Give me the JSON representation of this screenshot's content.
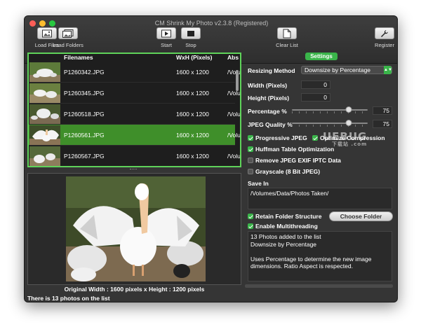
{
  "window": {
    "title": "CM Shrink My Photo v2.3.8 (Registered)"
  },
  "toolbar": {
    "load_files": "Load Files",
    "load_folders": "Load Folders",
    "start": "Start",
    "stop": "Stop",
    "clear_list": "Clear List",
    "register": "Register"
  },
  "filelist": {
    "columns": [
      "Filenames",
      "WxH (Pixels)",
      "Abs"
    ],
    "rows": [
      {
        "name": "P1260342.JPG",
        "dims": "1600 x 1200",
        "abs": "/Volu",
        "selected": false
      },
      {
        "name": "P1260345.JPG",
        "dims": "1600 x 1200",
        "abs": "/Volu",
        "selected": false
      },
      {
        "name": "P1260518.JPG",
        "dims": "1600 x 1200",
        "abs": "/Volu",
        "selected": false
      },
      {
        "name": "P1260561.JPG",
        "dims": "1600 x 1200",
        "abs": "/Volu",
        "selected": true
      },
      {
        "name": "P1260567.JPG",
        "dims": "1600 x 1200",
        "abs": "/Volu",
        "selected": false
      }
    ]
  },
  "preview": {
    "caption": "Original Width : 1600 pixels x Height : 1200 pixels",
    "status": "There is 13 photos on the list"
  },
  "settings": {
    "tab": "Settings",
    "resizing_method_label": "Resizing Method",
    "resizing_method_value": "Downsize by Percentage",
    "width_label": "Width (Pixels)",
    "width_value": "0",
    "height_label": "Height (Pixels)",
    "height_value": "0",
    "percentage_label": "Percentage %",
    "percentage_value": "75",
    "percentage_level": 0.75,
    "jpeg_quality_label": "JPEG Quality %",
    "jpeg_quality_value": "75",
    "jpeg_quality_level": 0.75,
    "progressive_jpeg": "Progressive JPEG",
    "optimize_compression": "Optimize Compression",
    "huffman": "Huffman Table Optimization",
    "remove_exif": "Remove JPEG EXIF  IPTC Data",
    "grayscale": "Grayscale (8 Bit JPEG)",
    "save_in_label": "Save In",
    "save_in_path": "/Volumes/Data/Photos Taken/",
    "retain_folder": "Retain Folder Structure",
    "enable_multithreading": "Enable Multithreading",
    "choose_folder": "Choose Folder",
    "log": "13 Photos added to the list\nDownsize by Percentage\n\nUses Percentage to determine the new image dimensions. Ratio Aspect is respected."
  },
  "watermark": {
    "text": "UEBUG",
    "sub": "下载站 .com"
  },
  "colors": {
    "accent": "#3ab54a",
    "selection": "#3f8f2a",
    "list_border": "#5fd35a",
    "window_bg": "#353535"
  }
}
